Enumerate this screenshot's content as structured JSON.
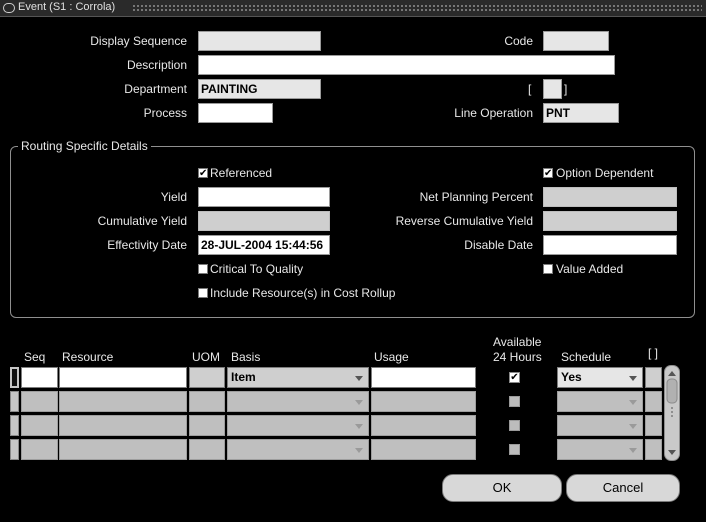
{
  "window": {
    "title": "Event (S1 : Corrola)"
  },
  "header": {
    "display_sequence_label": "Display Sequence",
    "display_sequence_value": "",
    "code_label": "Code",
    "code_value": "",
    "description_label": "Description",
    "description_value": "",
    "department_label": "Department",
    "department_value": "PAINTING",
    "flex_bracket_open": "[",
    "flex_bracket_close": "]",
    "process_label": "Process",
    "process_value": "",
    "line_operation_label": "Line Operation",
    "line_operation_value": "PNT"
  },
  "routing": {
    "group_title": "Routing Specific Details",
    "referenced_label": "Referenced",
    "referenced_checked": true,
    "option_dependent_label": "Option Dependent",
    "option_dependent_checked": true,
    "yield_label": "Yield",
    "yield_value": "",
    "net_planning_percent_label": "Net Planning Percent",
    "net_planning_percent_value": "",
    "cumulative_yield_label": "Cumulative Yield",
    "cumulative_yield_value": "",
    "reverse_cumulative_yield_label": "Reverse Cumulative Yield",
    "reverse_cumulative_yield_value": "",
    "effectivity_date_label": "Effectivity Date",
    "effectivity_date_value": "28-JUL-2004 15:44:56",
    "disable_date_label": "Disable Date",
    "disable_date_value": "",
    "critical_to_quality_label": "Critical To Quality",
    "critical_to_quality_checked": false,
    "value_added_label": "Value Added",
    "value_added_checked": false,
    "include_resources_label": "Include Resource(s) in Cost Rollup",
    "include_resources_checked": false
  },
  "resources_table": {
    "columns": {
      "seq": "Seq",
      "resource": "Resource",
      "uom": "UOM",
      "basis": "Basis",
      "usage": "Usage",
      "available_line1": "Available",
      "available_line2": "24 Hours",
      "schedule": "Schedule",
      "flex": "[ ]"
    },
    "rows": [
      {
        "seq": "",
        "resource": "",
        "uom": "",
        "basis": "Item",
        "usage": "",
        "available_24h": true,
        "schedule": "Yes"
      },
      {
        "seq": "",
        "resource": "",
        "uom": "",
        "basis": "",
        "usage": "",
        "available_24h": false,
        "schedule": ""
      },
      {
        "seq": "",
        "resource": "",
        "uom": "",
        "basis": "",
        "usage": "",
        "available_24h": false,
        "schedule": ""
      },
      {
        "seq": "",
        "resource": "",
        "uom": "",
        "basis": "",
        "usage": "",
        "available_24h": false,
        "schedule": ""
      }
    ]
  },
  "buttons": {
    "ok_label": "OK",
    "cancel_label": "Cancel"
  },
  "icons": {
    "window_icon": "window-menu-icon",
    "check": "check-icon",
    "dropdown": "chevron-down-icon"
  },
  "colors": {
    "background": "#000000",
    "field_white": "#ffffff",
    "field_disabled": "#cfcfcf",
    "button": "#d8d8d8"
  }
}
